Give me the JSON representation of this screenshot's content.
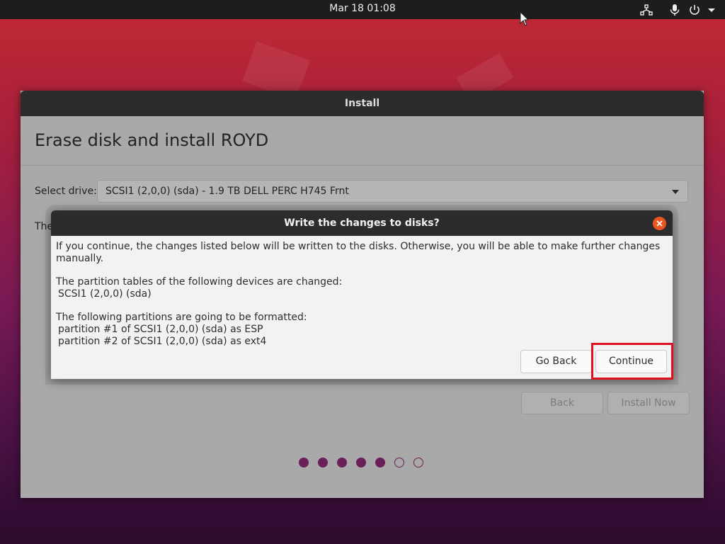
{
  "topbar": {
    "clock": "Mar 18  01:08",
    "icons": [
      "network-icon",
      "microphone-icon",
      "power-icon",
      "dropdown-arrow-icon"
    ]
  },
  "window": {
    "title": "Install",
    "heading": "Erase disk and install ROYD",
    "drive_label": "Select drive:",
    "drive_value": "SCSI1 (2,0,0) (sda) - 1.9 TB DELL PERC H745 Frnt",
    "partial_text": "The",
    "back_label": "Back",
    "install_now_label": "Install Now",
    "progress": {
      "total_steps": 7,
      "completed_steps": 5
    }
  },
  "dialog": {
    "title": "Write the changes to disks?",
    "intro": "If you continue, the changes listed below will be written to the disks. Otherwise, you will be able to make further changes manually.",
    "partition_tables_heading": "The partition tables of the following devices are changed:",
    "partition_tables_items": [
      " SCSI1 (2,0,0) (sda)"
    ],
    "formatted_heading": "The following partitions are going to be formatted:",
    "formatted_items": [
      " partition #1 of SCSI1 (2,0,0) (sda) as ESP",
      " partition #2 of SCSI1 (2,0,0) (sda) as ext4"
    ],
    "go_back_label": "Go Back",
    "continue_label": "Continue"
  },
  "colors": {
    "accent_orange": "#e95420",
    "highlight_red": "#e0101e",
    "progress_purple": "#6a1f58"
  }
}
